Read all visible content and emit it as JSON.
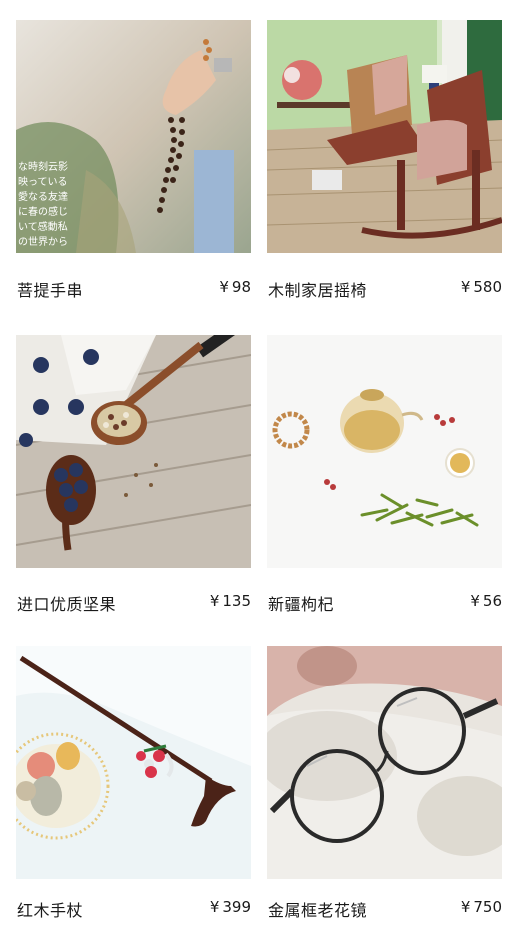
{
  "currency_symbol": "¥",
  "products": [
    {
      "name": "菩提手串",
      "price": "98",
      "image_icon": "prayer-beads-photo"
    },
    {
      "name": "木制家居摇椅",
      "price": "580",
      "image_icon": "rocking-chair-photo"
    },
    {
      "name": "进口优质坚果",
      "price": "135",
      "image_icon": "nuts-spoon-photo"
    },
    {
      "name": "新疆枸杞",
      "price": "56",
      "image_icon": "wolfberry-tea-photo"
    },
    {
      "name": "红木手杖",
      "price": "399",
      "image_icon": "walking-cane-photo"
    },
    {
      "name": "金属框老花镜",
      "price": "750",
      "image_icon": "reading-glasses-photo"
    }
  ]
}
